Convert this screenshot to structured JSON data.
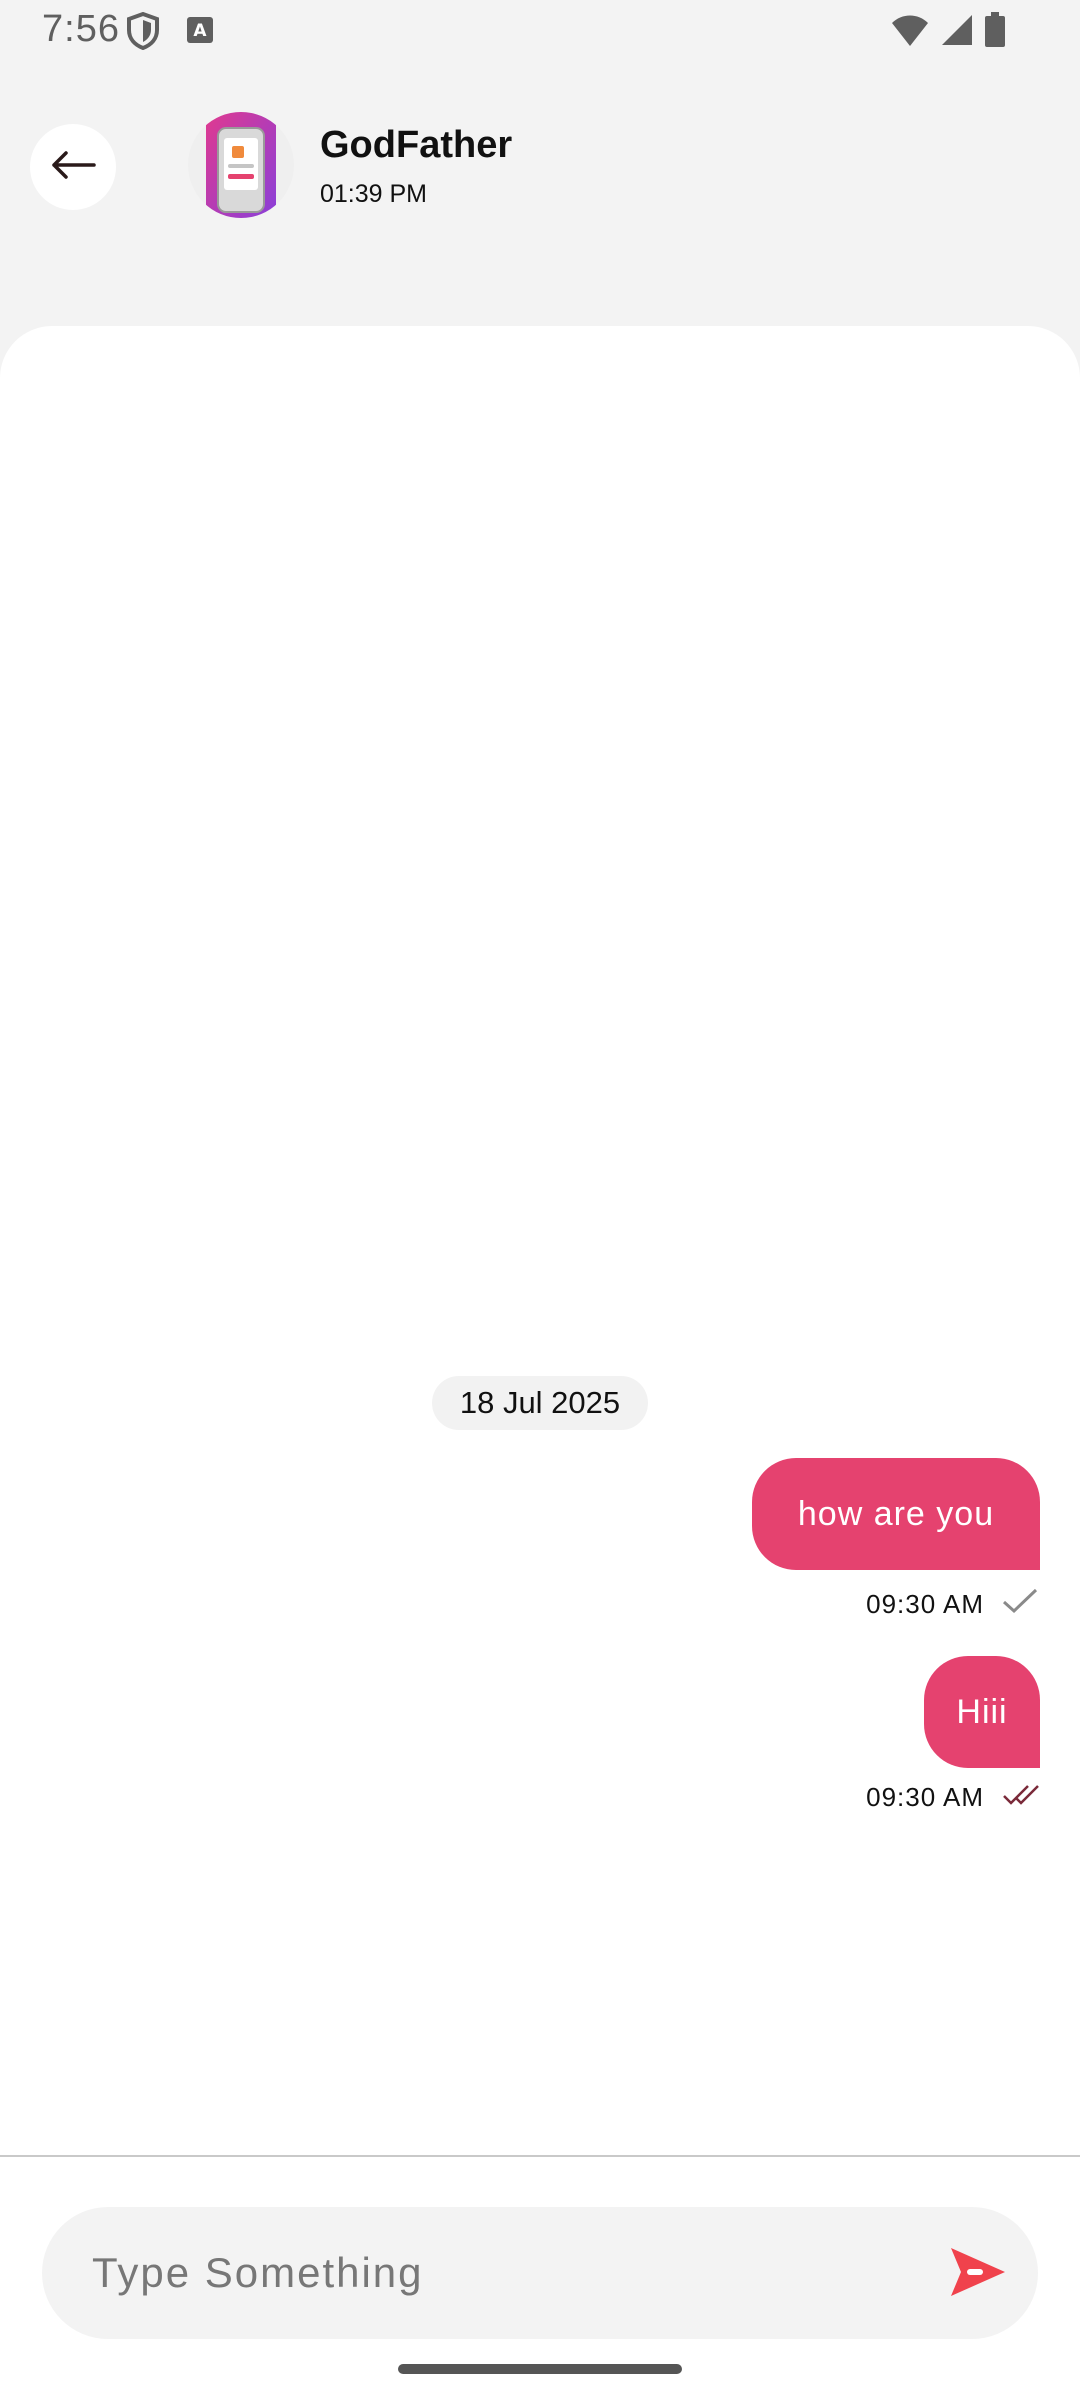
{
  "status_bar": {
    "time": "7:56",
    "icons": [
      "shield-icon",
      "keyboard-a-icon",
      "wifi-icon",
      "signal-icon",
      "battery-icon"
    ]
  },
  "header": {
    "back_icon": "arrow-left-icon",
    "contact_name": "GodFather",
    "contact_time": "01:39 PM"
  },
  "chat": {
    "date_label": "18 Jul 2025",
    "messages": [
      {
        "text": "how are you",
        "time": "09:30 AM",
        "status_icon": "single-check-icon"
      },
      {
        "text": "Hiii",
        "time": "09:30 AM",
        "status_icon": "double-check-icon"
      }
    ]
  },
  "composer": {
    "placeholder": "Type Something",
    "value": "",
    "send_icon": "send-icon"
  },
  "colors": {
    "accent": "#e5426f",
    "send": "#f0424c",
    "background": "#f3f3f3",
    "chat_background": "#ffffff"
  }
}
